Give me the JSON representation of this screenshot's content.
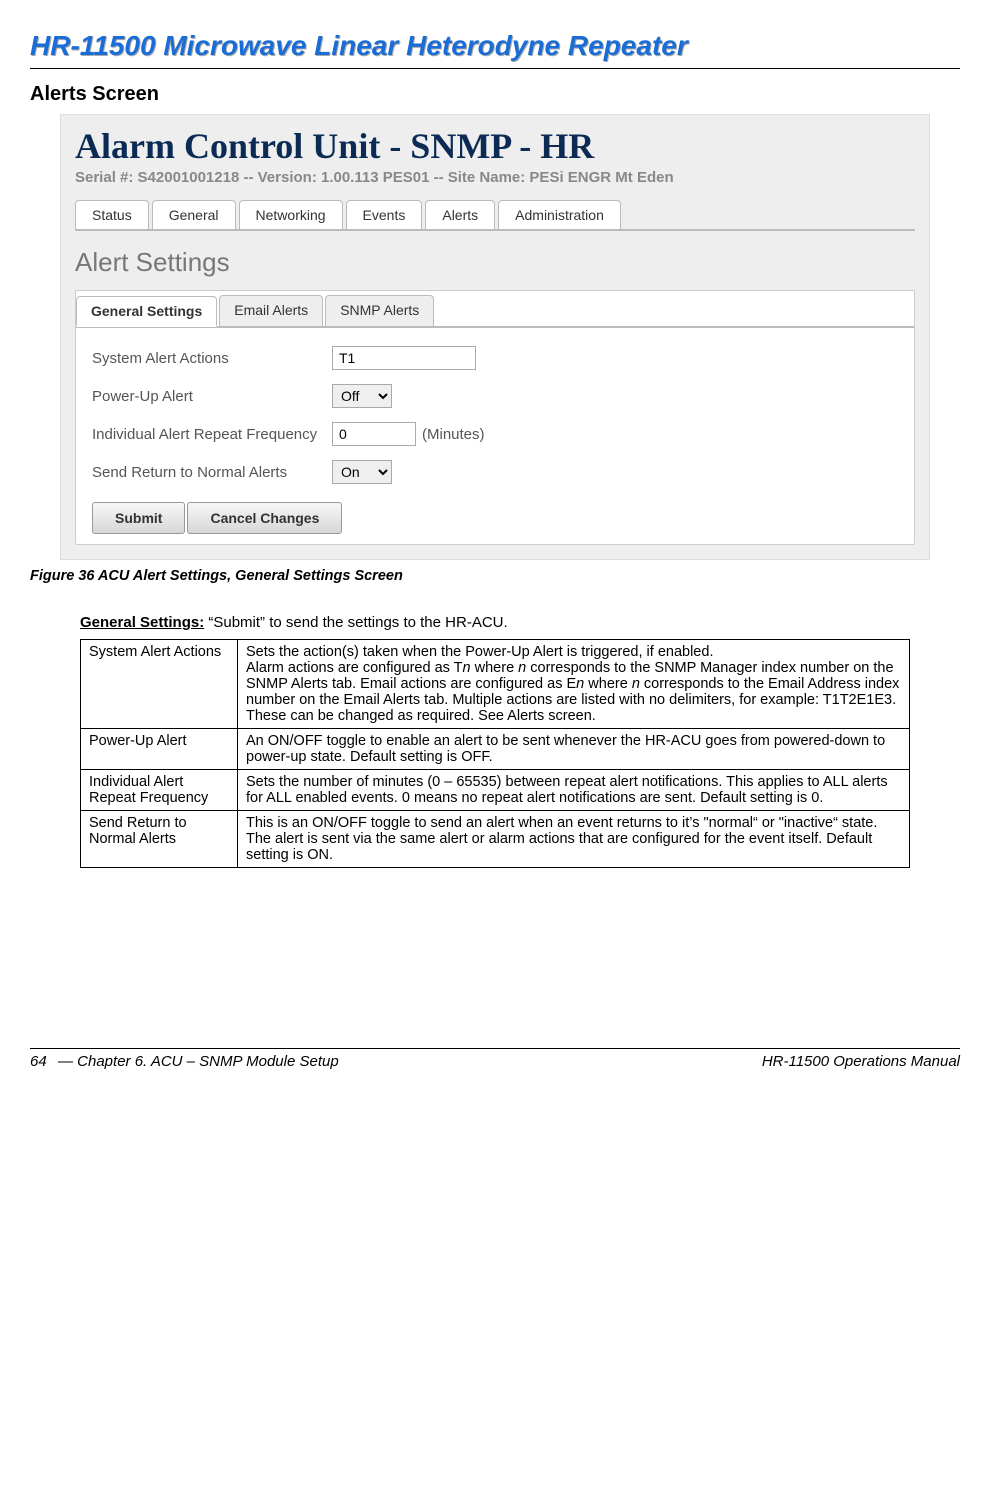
{
  "doc": {
    "title": "HR-11500 Microwave Linear Heterodyne Repeater",
    "section": "Alerts Screen",
    "figure_caption": "Figure 36  ACU Alert Settings, General Settings Screen"
  },
  "screenshot": {
    "title": "Alarm Control Unit - SNMP - HR",
    "meta": "Serial #: S42001001218   --   Version: 1.00.113 PES01   --   Site Name:  PESi ENGR Mt Eden",
    "topnav": [
      {
        "label": "Status",
        "name": "tab-status"
      },
      {
        "label": "General",
        "name": "tab-general"
      },
      {
        "label": "Networking",
        "name": "tab-networking"
      },
      {
        "label": "Events",
        "name": "tab-events"
      },
      {
        "label": "Alerts",
        "name": "tab-alerts"
      },
      {
        "label": "Administration",
        "name": "tab-administration"
      }
    ],
    "subnav_title": "Alert Settings",
    "subnav": [
      {
        "label": "General Settings",
        "name": "sub-tab-general-settings",
        "active": true
      },
      {
        "label": "Email Alerts",
        "name": "sub-tab-email-alerts",
        "active": false
      },
      {
        "label": "SNMP Alerts",
        "name": "sub-tab-snmp-alerts",
        "active": false
      }
    ],
    "fields": {
      "system_alert_actions": {
        "label": "System Alert Actions",
        "value": "T1"
      },
      "power_up_alert": {
        "label": "Power-Up Alert",
        "value": "Off"
      },
      "repeat_freq": {
        "label": "Individual Alert Repeat Frequency",
        "value": "0",
        "suffix": "(Minutes)"
      },
      "return_normal": {
        "label": "Send Return to Normal Alerts",
        "value": "On"
      }
    },
    "buttons": {
      "submit": "Submit",
      "cancel": "Cancel Changes"
    }
  },
  "settings_intro": {
    "label": "General Settings:",
    "text": " “Submit” to send the settings to the HR-ACU."
  },
  "desc_rows": [
    {
      "name": "System Alert Actions",
      "desc_html": "Sets the action(s) taken when the Power-Up Alert is triggered, if enabled.<br>Alarm actions are configured as T<span class=\"italic\">n</span> where <span class=\"italic\">n</span> corresponds to the SNMP Manager index number on the SNMP Alerts tab. Email actions are configured as E<span class=\"italic\">n</span> where <span class=\"italic\">n</span> corresponds to the Email Address index number on the Email Alerts tab. Multiple actions are listed with no delimiters, for example: T1T2E1E3. These can be changed as required. See Alerts screen."
    },
    {
      "name": "Power-Up Alert",
      "desc_html": "An ON/OFF toggle to enable an alert to be sent whenever the HR-ACU goes from powered-down to power-up state. Default setting is OFF."
    },
    {
      "name": "Individual Alert Repeat Frequency",
      "desc_html": "Sets the number of minutes (0 – 65535) between repeat alert notifications. This applies to ALL alerts for ALL enabled events. 0 means no repeat alert notifications are sent. Default setting is 0."
    },
    {
      "name": "Send Return to Normal Alerts",
      "desc_html": "This is an ON/OFF toggle to send an alert when an event returns to it’s \"normal“ or \"inactive“ state. The alert is sent via the same alert or alarm actions that are configured for the event itself. Default setting is ON."
    }
  ],
  "footer": {
    "page": "64",
    "chapter": "— Chapter 6. ACU – SNMP Module Setup",
    "manual": "HR-11500 Operations Manual"
  }
}
